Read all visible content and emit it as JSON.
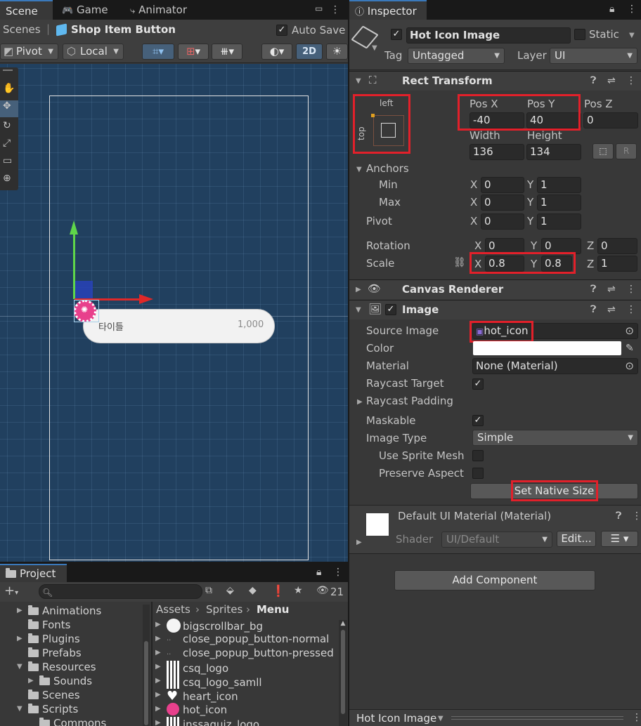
{
  "tabs_left": {
    "scene": "Scene",
    "game": "Game",
    "animator": "Animator"
  },
  "scene_bar": {
    "scenes": "Scenes",
    "object": "Shop Item Button",
    "auto_save": "Auto Save"
  },
  "scene_tools": {
    "pivot": "Pivot",
    "local": "Local",
    "mode2d": "2D"
  },
  "scene_canvas": {
    "label_text": "타이틀",
    "price_text": "1,000"
  },
  "inspector": {
    "tab": "Inspector",
    "object_name": "Hot Icon Image",
    "static_label": "Static",
    "tag_label": "Tag",
    "tag_value": "Untagged",
    "layer_label": "Layer",
    "layer_value": "UI"
  },
  "rect_transform": {
    "title": "Rect Transform",
    "anchor_h": "left",
    "anchor_v": "top",
    "pos_x_label": "Pos X",
    "pos_y_label": "Pos Y",
    "pos_z_label": "Pos Z",
    "pos_x": "-40",
    "pos_y": "40",
    "pos_z": "0",
    "width_label": "Width",
    "height_label": "Height",
    "width": "136",
    "height": "134",
    "anchors_label": "Anchors",
    "min_label": "Min",
    "max_label": "Max",
    "pivot_label": "Pivot",
    "min_x": "0",
    "min_y": "1",
    "max_x": "0",
    "max_y": "1",
    "pivot_x": "0",
    "pivot_y": "1",
    "rotation_label": "Rotation",
    "rot_x": "0",
    "rot_y": "0",
    "rot_z": "0",
    "scale_label": "Scale",
    "scale_x": "0.8",
    "scale_y": "0.8",
    "scale_z": "1",
    "x": "X",
    "y": "Y",
    "z": "Z",
    "r_btn": "R"
  },
  "canvas_renderer": {
    "title": "Canvas Renderer"
  },
  "image": {
    "title": "Image",
    "source_label": "Source Image",
    "source_value": "hot_icon",
    "color_label": "Color",
    "material_label": "Material",
    "material_value": "None (Material)",
    "raycast_label": "Raycast Target",
    "raycast_padding_label": "Raycast Padding",
    "maskable_label": "Maskable",
    "image_type_label": "Image Type",
    "image_type_value": "Simple",
    "sprite_mesh_label": "Use Sprite Mesh",
    "preserve_label": "Preserve Aspect",
    "native_size_btn": "Set Native Size"
  },
  "material_section": {
    "title": "Default UI Material (Material)",
    "shader_label": "Shader",
    "shader_value": "UI/Default",
    "edit_btn": "Edit..."
  },
  "add_component": "Add Component",
  "bottom_bar": {
    "selection": "Hot Icon Image"
  },
  "project": {
    "tab": "Project",
    "count": "21",
    "tree": [
      "Animations",
      "Fonts",
      "Plugins",
      "Prefabs",
      "Resources",
      "Sounds",
      "Scenes",
      "Scripts",
      "Commons"
    ],
    "breadcrumb": [
      "Assets",
      "Sprites",
      "Menu"
    ],
    "assets": [
      "bigscrollbar_bg",
      "close_popup_button-normal",
      "close_popup_button-pressed",
      "csq_logo",
      "csq_logo_samll",
      "heart_icon",
      "hot_icon",
      "inssaquiz_logo"
    ]
  },
  "colors": {
    "accent": "#3a79bb",
    "highlight": "#e2202a",
    "scene_bg": "#21405f",
    "selection": "#2c5d87"
  }
}
